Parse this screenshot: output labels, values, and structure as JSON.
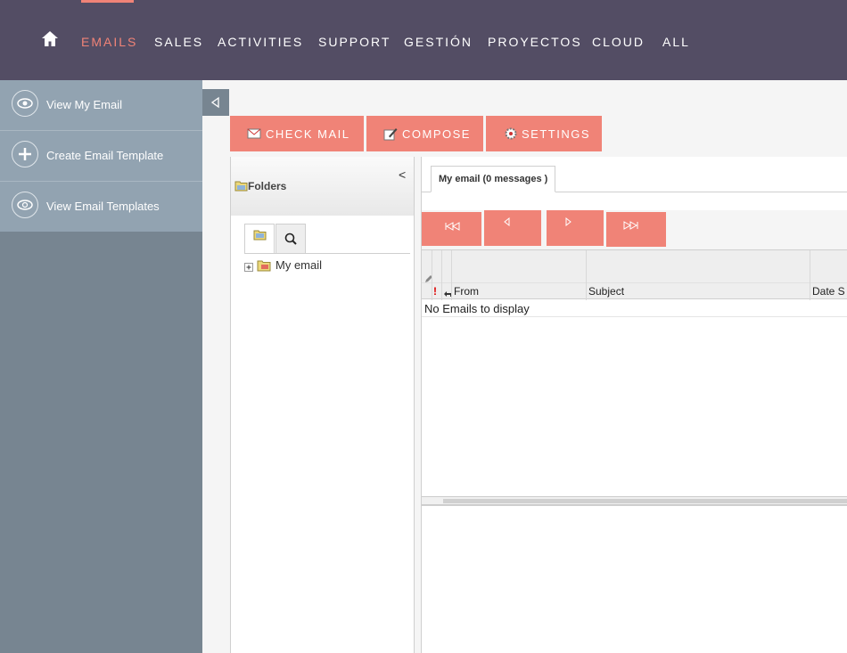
{
  "colors": {
    "nav_bg": "#534d64",
    "accent": "#f08377",
    "sidebar_bg": "#778591",
    "sidebar_menu_bg": "#92a3b1"
  },
  "nav": {
    "home_icon": "home-icon",
    "items": [
      {
        "label": "EMAILS",
        "active": true
      },
      {
        "label": "SALES"
      },
      {
        "label": "ACTIVITIES"
      },
      {
        "label": "SUPPORT"
      },
      {
        "label": "GESTIÓN"
      },
      {
        "label": "PROYECTOS"
      },
      {
        "label": "CLOUD"
      },
      {
        "label": "ALL"
      }
    ]
  },
  "sidebar": {
    "items": [
      {
        "label": "View My Email",
        "icon": "eye-icon"
      },
      {
        "label": "Create Email Template",
        "icon": "plus-icon"
      },
      {
        "label": "View Email Templates",
        "icon": "at-eye-icon"
      }
    ],
    "collapse_icon": "triangle-left-icon"
  },
  "actions": {
    "check_mail": "CHECK MAIL",
    "compose": "COMPOSE",
    "settings": "SETTINGS"
  },
  "folders": {
    "title": "Folders",
    "collapse": "<",
    "tree": [
      {
        "label": "My email",
        "icon": "folder-icon"
      }
    ]
  },
  "mailbox": {
    "tab_label": "My email (0 messages )",
    "columns": {
      "flag": "!",
      "from": "From",
      "subject": "Subject",
      "date": "Date S"
    },
    "empty_message": "No Emails to display"
  }
}
